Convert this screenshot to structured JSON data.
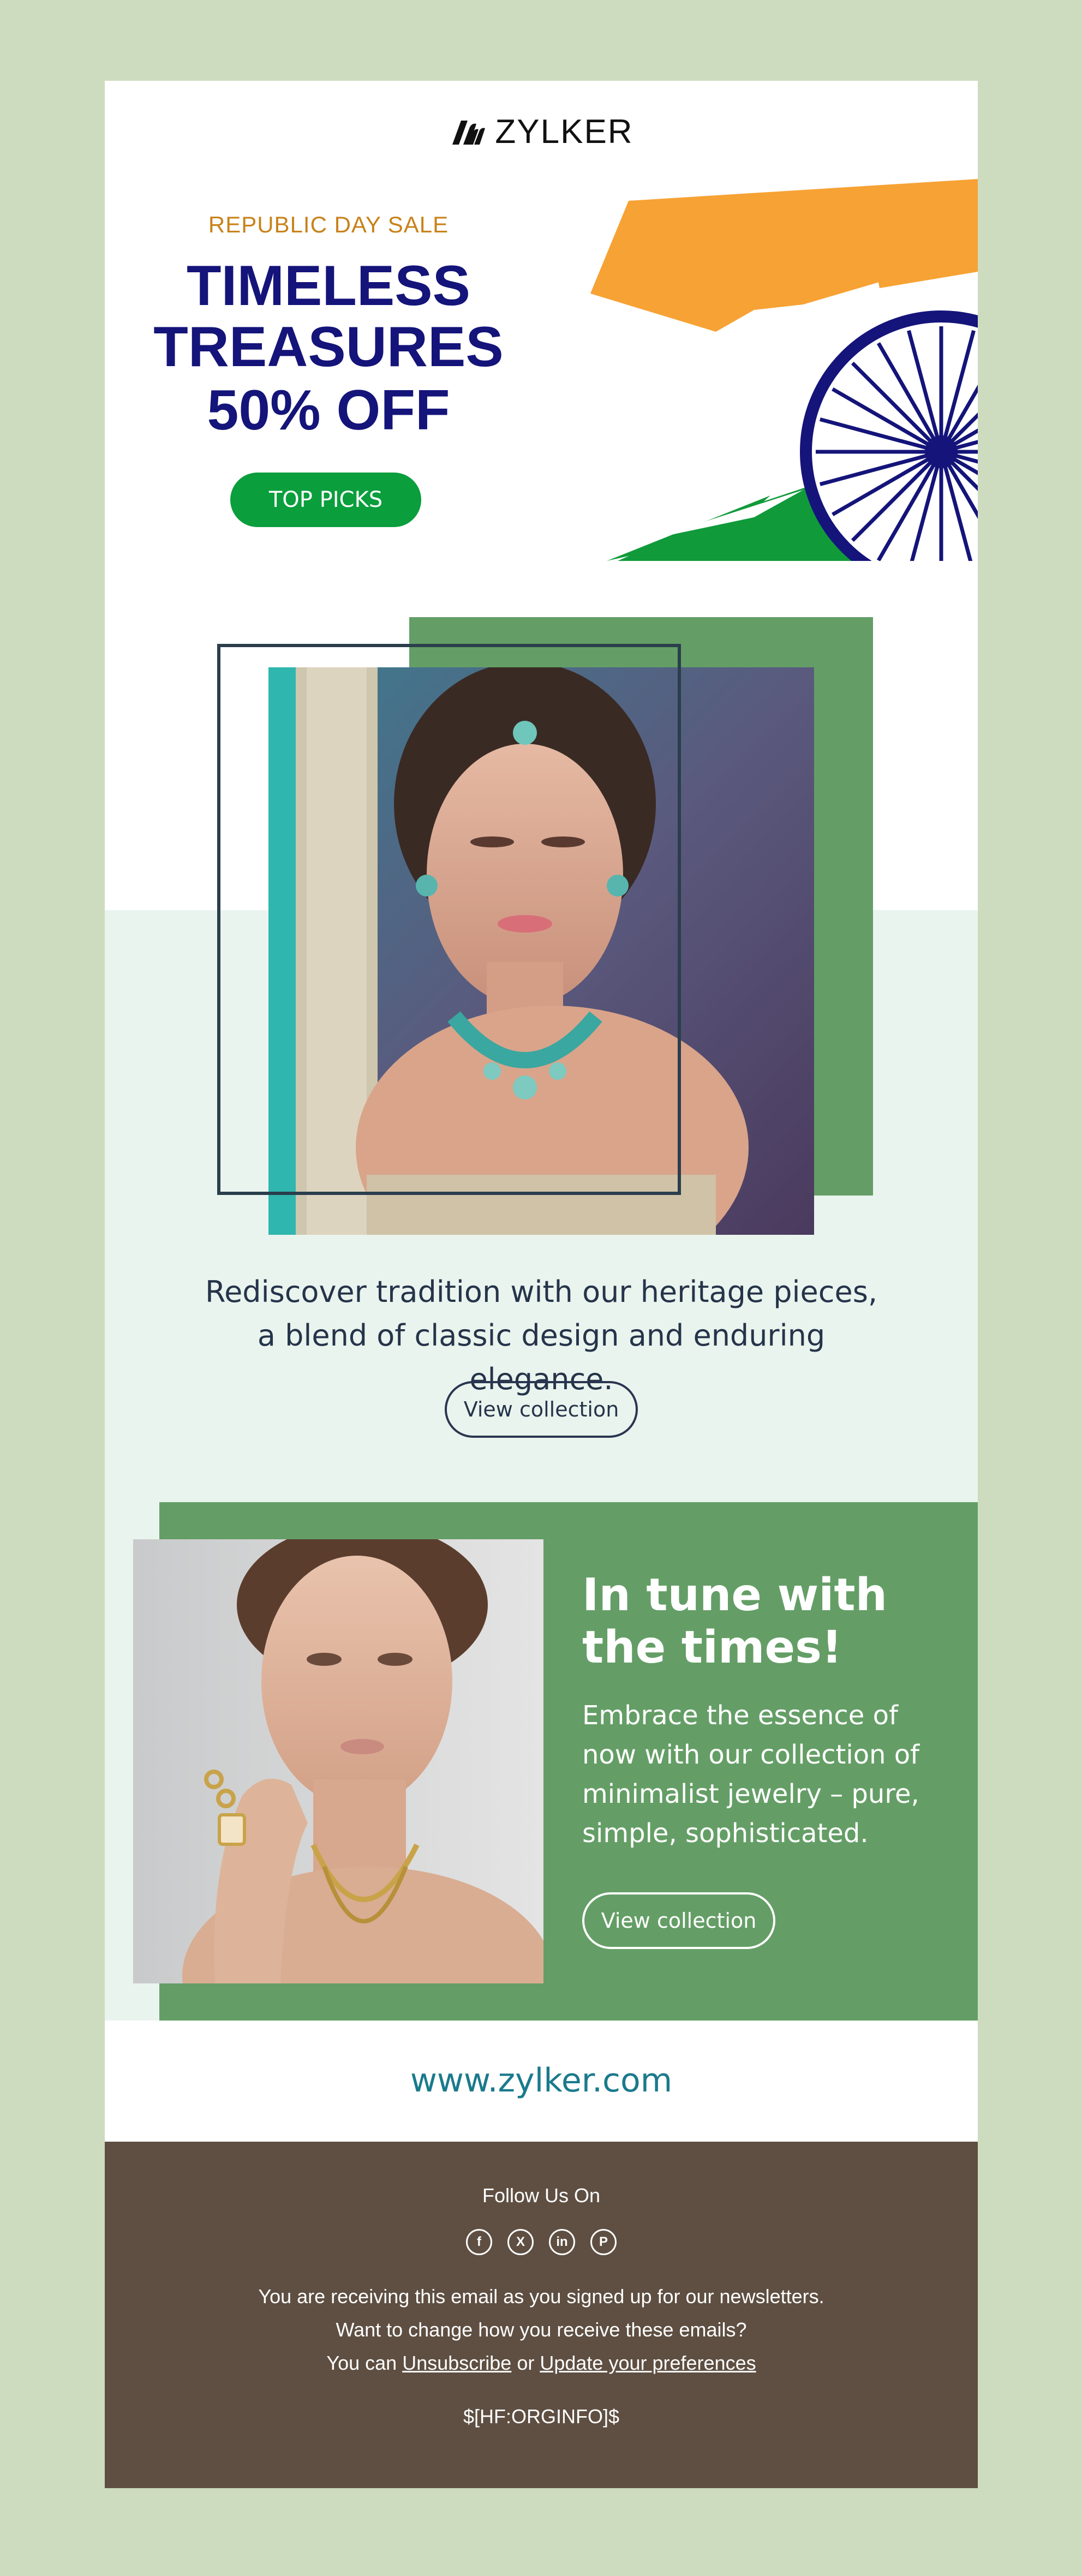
{
  "brand": {
    "name": "ZYLKER",
    "logo_icon": "zylker-mark-icon"
  },
  "hero": {
    "sale_tag": "REPUBLIC DAY SALE",
    "title_line1": "TIMELESS",
    "title_line2": "TREASURES",
    "discount": "50% OFF",
    "cta_label": "TOP PICKS"
  },
  "heritage": {
    "blurb": "Rediscover tradition with our heritage pieces, a blend of classic design and enduring elegance.",
    "cta_label": "View collection"
  },
  "minimal": {
    "title": "In tune with the times!",
    "body": "Embrace the essence of now with our collection of minimalist jewelry – pure, simple, sophisticated.",
    "cta_label": "View collection"
  },
  "site": {
    "url": "www.zylker.com"
  },
  "footer": {
    "follow_label": "Follow Us On",
    "socials": [
      "facebook-icon",
      "x-icon",
      "linkedin-icon",
      "pinterest-icon"
    ],
    "line1": "You are receiving this email as you signed up for our newsletters.",
    "line2": "Want to change how you receive these emails?",
    "line3_prefix": "You can",
    "unsubscribe_label": "Unsubscribe",
    "line3_joiner": "or",
    "preferences_label": "Update your preferences",
    "org_info": "$[HF:ORGINFO]$"
  },
  "colors": {
    "page_bg": "#cddcbe",
    "saffron": "#f7a234",
    "india_green": "#109a3a",
    "navy": "#14147a",
    "sage_green": "#649e66",
    "mint": "#eaf4ee",
    "footer_brown": "#5e4f42",
    "link_teal": "#1a7a8c"
  }
}
